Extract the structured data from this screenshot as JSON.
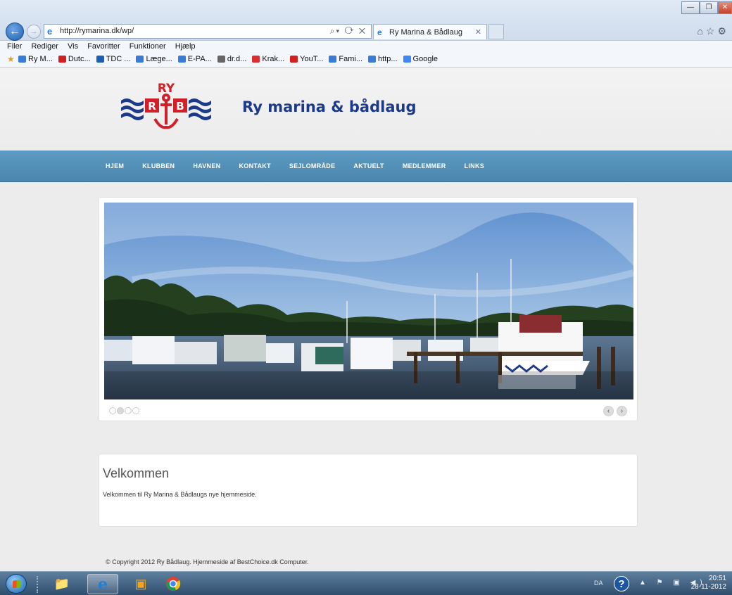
{
  "browser": {
    "url": "http://rymarina.dk/wp/",
    "tab_title": "Ry Marina & Bådlaug",
    "menu": [
      "Filer",
      "Rediger",
      "Vis",
      "Favoritter",
      "Funktioner",
      "Hjælp"
    ],
    "favorites": [
      {
        "label": "Ry M...",
        "color": "#3a7bd5"
      },
      {
        "label": "Dutc...",
        "color": "#d22020"
      },
      {
        "label": "TDC ...",
        "color": "#1a5fb4"
      },
      {
        "label": "Læge...",
        "color": "#3a7bd5"
      },
      {
        "label": "E-PA...",
        "color": "#3a7bd5"
      },
      {
        "label": "dr.d...",
        "color": "#666666"
      },
      {
        "label": "Krak...",
        "color": "#d83030"
      },
      {
        "label": "YouT...",
        "color": "#d22020"
      },
      {
        "label": "Fami...",
        "color": "#3a7bd5"
      },
      {
        "label": "http...",
        "color": "#3a7bd5"
      },
      {
        "label": "Google",
        "color": "#4285f4"
      }
    ]
  },
  "site": {
    "logo_letters": "RY",
    "title": "Ry marina & bådlaug",
    "nav": [
      "HJEM",
      "KLUBBEN",
      "HAVNEN",
      "KONTAKT",
      "SEJLOMRÅDE",
      "AKTUELT",
      "MEDLEMMER",
      "LINKS"
    ],
    "welcome_title": "Velkommen",
    "welcome_text": "Velkommen til Ry Marina & Bådlaugs nye hjemmeside.",
    "copyright": "© Copyright 2012 Ry Bådlaug. Hjemmeside af BestChoice.dk Computer."
  },
  "taskbar": {
    "lang": "DA",
    "time": "20:51",
    "date": "28-11-2012"
  },
  "colors": {
    "nav_blue": "#4a86ae",
    "title_blue": "#1c3a87",
    "logo_red": "#d0202a"
  }
}
